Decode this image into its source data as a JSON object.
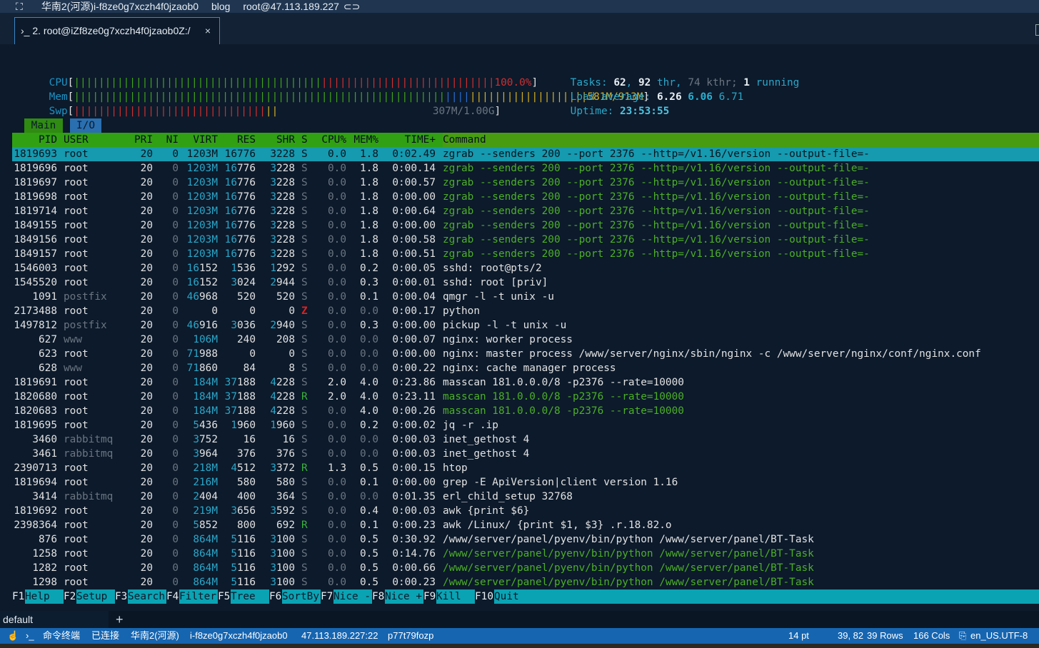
{
  "titlebar": {
    "expand_glyph": "⛶",
    "server": "华南2(河源)i-f8ze0g7xczh4f0jzaob0",
    "group": "blog",
    "connection": "root@47.113.189.227"
  },
  "tab": {
    "prompt_glyph": "›_",
    "title": "2. root@iZf8ze0g7xczh4f0jzaob0Z:/",
    "close": "×"
  },
  "meters": {
    "cpu": {
      "label": "CPU",
      "value": "100.0%"
    },
    "mem": {
      "label": "Mem",
      "value": "581M/913M"
    },
    "swp": {
      "label": "Swp",
      "value": "307M/1.00G"
    }
  },
  "summary": {
    "tasks_label": "Tasks:",
    "tasks": "62",
    "thr": "92",
    "thr_label": "thr,",
    "kthr": "74 kthr;",
    "running": "1",
    "running_label": "running",
    "load_label": "Load average:",
    "load1": "6.26",
    "load5": "6.06",
    "load15": "6.71",
    "uptime_label": "Uptime:",
    "uptime": "23:53:55"
  },
  "screen_tabs": [
    "Main",
    "I/O"
  ],
  "columns": [
    "PID",
    "USER",
    "PRI",
    "NI",
    "VIRT",
    "RES",
    "SHR",
    "S",
    "CPU%",
    "MEM%",
    "TIME+",
    "Command"
  ],
  "processes": [
    {
      "pid": "1819693",
      "user": "root",
      "pri": "20",
      "ni": "0",
      "virt": "1203M",
      "res": "16776",
      "shr": "3228",
      "s": "S",
      "cpu": "0.0",
      "mem": "1.8",
      "time": "0:02.49",
      "cmd": "zgrab --senders 200 --port 2376 --http=/v1.16/version --output-file=-",
      "sel": true
    },
    {
      "pid": "1819696",
      "user": "root",
      "pri": "20",
      "ni": "0",
      "virt": "1203M",
      "res": "16776",
      "shr": "3228",
      "s": "S",
      "cpu": "0.0",
      "mem": "1.8",
      "time": "0:00.14",
      "cmd": "zgrab --senders 200 --port 2376 --http=/v1.16/version --output-file=-",
      "green": true
    },
    {
      "pid": "1819697",
      "user": "root",
      "pri": "20",
      "ni": "0",
      "virt": "1203M",
      "res": "16776",
      "shr": "3228",
      "s": "S",
      "cpu": "0.0",
      "mem": "1.8",
      "time": "0:00.57",
      "cmd": "zgrab --senders 200 --port 2376 --http=/v1.16/version --output-file=-",
      "green": true
    },
    {
      "pid": "1819698",
      "user": "root",
      "pri": "20",
      "ni": "0",
      "virt": "1203M",
      "res": "16776",
      "shr": "3228",
      "s": "S",
      "cpu": "0.0",
      "mem": "1.8",
      "time": "0:00.00",
      "cmd": "zgrab --senders 200 --port 2376 --http=/v1.16/version --output-file=-",
      "green": true
    },
    {
      "pid": "1819714",
      "user": "root",
      "pri": "20",
      "ni": "0",
      "virt": "1203M",
      "res": "16776",
      "shr": "3228",
      "s": "S",
      "cpu": "0.0",
      "mem": "1.8",
      "time": "0:00.64",
      "cmd": "zgrab --senders 200 --port 2376 --http=/v1.16/version --output-file=-",
      "green": true
    },
    {
      "pid": "1849155",
      "user": "root",
      "pri": "20",
      "ni": "0",
      "virt": "1203M",
      "res": "16776",
      "shr": "3228",
      "s": "S",
      "cpu": "0.0",
      "mem": "1.8",
      "time": "0:00.00",
      "cmd": "zgrab --senders 200 --port 2376 --http=/v1.16/version --output-file=-",
      "green": true
    },
    {
      "pid": "1849156",
      "user": "root",
      "pri": "20",
      "ni": "0",
      "virt": "1203M",
      "res": "16776",
      "shr": "3228",
      "s": "S",
      "cpu": "0.0",
      "mem": "1.8",
      "time": "0:00.58",
      "cmd": "zgrab --senders 200 --port 2376 --http=/v1.16/version --output-file=-",
      "green": true
    },
    {
      "pid": "1849157",
      "user": "root",
      "pri": "20",
      "ni": "0",
      "virt": "1203M",
      "res": "16776",
      "shr": "3228",
      "s": "S",
      "cpu": "0.0",
      "mem": "1.8",
      "time": "0:00.51",
      "cmd": "zgrab --senders 200 --port 2376 --http=/v1.16/version --output-file=-",
      "green": true
    },
    {
      "pid": "1546003",
      "user": "root",
      "pri": "20",
      "ni": "0",
      "virt": "16152",
      "res": "1536",
      "shr": "1292",
      "s": "S",
      "cpu": "0.0",
      "mem": "0.2",
      "time": "0:00.05",
      "cmd": "sshd: root@pts/2"
    },
    {
      "pid": "1545520",
      "user": "root",
      "pri": "20",
      "ni": "0",
      "virt": "16152",
      "res": "3024",
      "shr": "2944",
      "s": "S",
      "cpu": "0.0",
      "mem": "0.3",
      "time": "0:00.01",
      "cmd": "sshd: root [priv]"
    },
    {
      "pid": "1091",
      "user": "postfix",
      "pri": "20",
      "ni": "0",
      "virt": "46968",
      "res": "520",
      "shr": "520",
      "s": "S",
      "cpu": "0.0",
      "mem": "0.1",
      "time": "0:00.04",
      "cmd": "qmgr -l -t unix -u",
      "dimuser": true
    },
    {
      "pid": "2173488",
      "user": "root",
      "pri": "20",
      "ni": "0",
      "virt": "0",
      "res": "0",
      "shr": "0",
      "s": "Z",
      "cpu": "0.0",
      "mem": "0.0",
      "time": "0:00.17",
      "cmd": "python"
    },
    {
      "pid": "1497812",
      "user": "postfix",
      "pri": "20",
      "ni": "0",
      "virt": "46916",
      "res": "3036",
      "shr": "2940",
      "s": "S",
      "cpu": "0.0",
      "mem": "0.3",
      "time": "0:00.00",
      "cmd": "pickup -l -t unix -u",
      "dimuser": true
    },
    {
      "pid": "627",
      "user": "www",
      "pri": "20",
      "ni": "0",
      "virt": "106M",
      "res": "240",
      "shr": "208",
      "s": "S",
      "cpu": "0.0",
      "mem": "0.0",
      "time": "0:00.07",
      "cmd": "nginx: worker process",
      "dimuser": true
    },
    {
      "pid": "623",
      "user": "root",
      "pri": "20",
      "ni": "0",
      "virt": "71988",
      "res": "0",
      "shr": "0",
      "s": "S",
      "cpu": "0.0",
      "mem": "0.0",
      "time": "0:00.00",
      "cmd": "nginx: master process /www/server/nginx/sbin/nginx -c /www/server/nginx/conf/nginx.conf"
    },
    {
      "pid": "628",
      "user": "www",
      "pri": "20",
      "ni": "0",
      "virt": "71860",
      "res": "84",
      "shr": "8",
      "s": "S",
      "cpu": "0.0",
      "mem": "0.0",
      "time": "0:00.22",
      "cmd": "nginx: cache manager process",
      "dimuser": true
    },
    {
      "pid": "1819691",
      "user": "root",
      "pri": "20",
      "ni": "0",
      "virt": "184M",
      "res": "37188",
      "shr": "4228",
      "s": "S",
      "cpu": "2.0",
      "mem": "4.0",
      "time": "0:23.86",
      "cmd": "masscan 181.0.0.0/8 -p2376 --rate=10000"
    },
    {
      "pid": "1820680",
      "user": "root",
      "pri": "20",
      "ni": "0",
      "virt": "184M",
      "res": "37188",
      "shr": "4228",
      "s": "R",
      "cpu": "2.0",
      "mem": "4.0",
      "time": "0:23.11",
      "cmd": "masscan 181.0.0.0/8 -p2376 --rate=10000",
      "green": true
    },
    {
      "pid": "1820683",
      "user": "root",
      "pri": "20",
      "ni": "0",
      "virt": "184M",
      "res": "37188",
      "shr": "4228",
      "s": "S",
      "cpu": "0.0",
      "mem": "4.0",
      "time": "0:00.26",
      "cmd": "masscan 181.0.0.0/8 -p2376 --rate=10000",
      "green": true
    },
    {
      "pid": "1819695",
      "user": "root",
      "pri": "20",
      "ni": "0",
      "virt": "5436",
      "res": "1960",
      "shr": "1960",
      "s": "S",
      "cpu": "0.0",
      "mem": "0.2",
      "time": "0:00.02",
      "cmd": "jq -r .ip"
    },
    {
      "pid": "3460",
      "user": "rabbitmq",
      "pri": "20",
      "ni": "0",
      "virt": "3752",
      "res": "16",
      "shr": "16",
      "s": "S",
      "cpu": "0.0",
      "mem": "0.0",
      "time": "0:00.03",
      "cmd": "inet_gethost 4",
      "dimuser": true
    },
    {
      "pid": "3461",
      "user": "rabbitmq",
      "pri": "20",
      "ni": "0",
      "virt": "3964",
      "res": "376",
      "shr": "376",
      "s": "S",
      "cpu": "0.0",
      "mem": "0.0",
      "time": "0:00.03",
      "cmd": "inet_gethost 4",
      "dimuser": true
    },
    {
      "pid": "2390713",
      "user": "root",
      "pri": "20",
      "ni": "0",
      "virt": "218M",
      "res": "4512",
      "shr": "3372",
      "s": "R",
      "cpu": "1.3",
      "mem": "0.5",
      "time": "0:00.15",
      "cmd": "htop"
    },
    {
      "pid": "1819694",
      "user": "root",
      "pri": "20",
      "ni": "0",
      "virt": "216M",
      "res": "580",
      "shr": "580",
      "s": "S",
      "cpu": "0.0",
      "mem": "0.1",
      "time": "0:00.00",
      "cmd": "grep -E ApiVersion|client version 1.16"
    },
    {
      "pid": "3414",
      "user": "rabbitmq",
      "pri": "20",
      "ni": "0",
      "virt": "2404",
      "res": "400",
      "shr": "364",
      "s": "S",
      "cpu": "0.0",
      "mem": "0.0",
      "time": "0:01.35",
      "cmd": "erl_child_setup 32768",
      "dimuser": true
    },
    {
      "pid": "1819692",
      "user": "root",
      "pri": "20",
      "ni": "0",
      "virt": "219M",
      "res": "3656",
      "shr": "3592",
      "s": "S",
      "cpu": "0.0",
      "mem": "0.4",
      "time": "0:00.03",
      "cmd": "awk {print $6}"
    },
    {
      "pid": "2398364",
      "user": "root",
      "pri": "20",
      "ni": "0",
      "virt": "5852",
      "res": "800",
      "shr": "692",
      "s": "R",
      "cpu": "0.0",
      "mem": "0.1",
      "time": "0:00.23",
      "cmd": "awk /Linux/ {print $1, $3} .r.18.82.o"
    },
    {
      "pid": "876",
      "user": "root",
      "pri": "20",
      "ni": "0",
      "virt": "864M",
      "res": "5116",
      "shr": "3100",
      "s": "S",
      "cpu": "0.0",
      "mem": "0.5",
      "time": "0:30.92",
      "cmd": "/www/server/panel/pyenv/bin/python /www/server/panel/BT-Task"
    },
    {
      "pid": "1258",
      "user": "root",
      "pri": "20",
      "ni": "0",
      "virt": "864M",
      "res": "5116",
      "shr": "3100",
      "s": "S",
      "cpu": "0.0",
      "mem": "0.5",
      "time": "0:14.76",
      "cmd": "/www/server/panel/pyenv/bin/python /www/server/panel/BT-Task",
      "green": true
    },
    {
      "pid": "1282",
      "user": "root",
      "pri": "20",
      "ni": "0",
      "virt": "864M",
      "res": "5116",
      "shr": "3100",
      "s": "S",
      "cpu": "0.0",
      "mem": "0.5",
      "time": "0:00.66",
      "cmd": "/www/server/panel/pyenv/bin/python /www/server/panel/BT-Task",
      "green": true
    },
    {
      "pid": "1298",
      "user": "root",
      "pri": "20",
      "ni": "0",
      "virt": "864M",
      "res": "5116",
      "shr": "3100",
      "s": "S",
      "cpu": "0.0",
      "mem": "0.5",
      "time": "0:00.23",
      "cmd": "/www/server/panel/pyenv/bin/python /www/server/panel/BT-Task",
      "green": true
    }
  ],
  "fkeys": [
    {
      "key": "F1",
      "label": "Help"
    },
    {
      "key": "F2",
      "label": "Setup"
    },
    {
      "key": "F3",
      "label": "Search"
    },
    {
      "key": "F4",
      "label": "Filter"
    },
    {
      "key": "F5",
      "label": "Tree"
    },
    {
      "key": "F6",
      "label": "SortBy"
    },
    {
      "key": "F7",
      "label": "Nice -"
    },
    {
      "key": "F8",
      "label": "Nice +"
    },
    {
      "key": "F9",
      "label": "Kill"
    },
    {
      "key": "F10",
      "label": "Quit"
    }
  ],
  "bottom_tabs": {
    "default": "default",
    "add": "+"
  },
  "statusbar": {
    "terminal_label": "命令终端",
    "connected": "已连接",
    "region": "华南2(河源)",
    "instance": "i-f8ze0g7xczh4f0jzaob0",
    "address": "47.113.189.227:22",
    "session": "p77t79fozp",
    "font_size": "14 pt",
    "cursor": "39, 82",
    "rows": "39 Rows",
    "cols": "166 Cols",
    "encoding": "en_US.UTF-8"
  },
  "colors": {
    "accent": "#1665b0",
    "header_green": "#31a012",
    "selected_row": "#159ab0"
  }
}
